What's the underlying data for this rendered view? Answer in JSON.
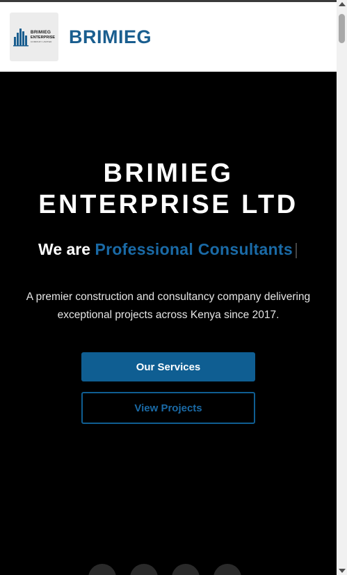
{
  "header": {
    "logo": {
      "line1": "BRIMIEG",
      "line2": "ENTERPRISE",
      "line3": "COMPANY LIMITED",
      "icon": "building-bars-icon"
    },
    "brand": "BRIMIEG"
  },
  "hero": {
    "title_line1": "BRIMIEG",
    "title_line2": "ENTERPRISE LTD",
    "tagline_prefix": "We are",
    "tagline_highlight": "Professional Consultants",
    "cursor": "|",
    "description": "A premier construction and consultancy company delivering exceptional projects across Kenya since 2017.",
    "primary_button": "Our Services",
    "secondary_button": "View Projects"
  },
  "social_icons": [
    "social-icon-1",
    "social-icon-2",
    "social-icon-3",
    "social-icon-4"
  ],
  "colors": {
    "accent": "#1a5e8f",
    "button": "#0f5e92",
    "background": "#000000",
    "header_bg": "#ffffff"
  }
}
